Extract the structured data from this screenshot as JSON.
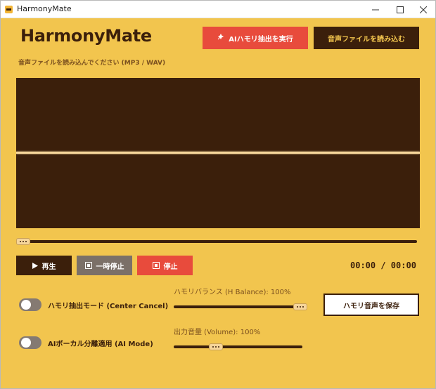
{
  "window": {
    "title": "HarmonyMate",
    "controls": {
      "minimize": "minimize-icon",
      "maximize": "maximize-icon",
      "close": "close-icon"
    }
  },
  "header": {
    "logo": "HarmonyMate",
    "ai_extract_button": "AIハモリ抽出を実行",
    "ai_extract_icon": "sparkle-icon",
    "load_button": "音声ファイルを読み込む"
  },
  "hint": "音声ファイルを読み込んでください (MP3 / WAV)",
  "playback": {
    "progress": 0,
    "play_label": "再生",
    "pause_label": "一時停止",
    "stop_label": "停止",
    "time_display": "00:00 / 00:00"
  },
  "settings": {
    "center_cancel_label": "ハモリ抽出モード (Center Cancel)",
    "center_cancel_on": false,
    "ai_mode_label": "AIボーカル分離適用 (AI Mode)",
    "ai_mode_on": false,
    "h_balance_label": "ハモリバランス (H Balance): 100%",
    "h_balance_value": 1.0,
    "volume_label": "出力音量 (Volume): 100%",
    "volume_value": 0.33,
    "save_button": "ハモリ音声を保存"
  },
  "colors": {
    "background": "#f2c54e",
    "dark_brown": "#3b1f0b",
    "accent_red": "#e84b3c",
    "muted_gray": "#7b7068",
    "waveform_line": "#f6d59a"
  }
}
